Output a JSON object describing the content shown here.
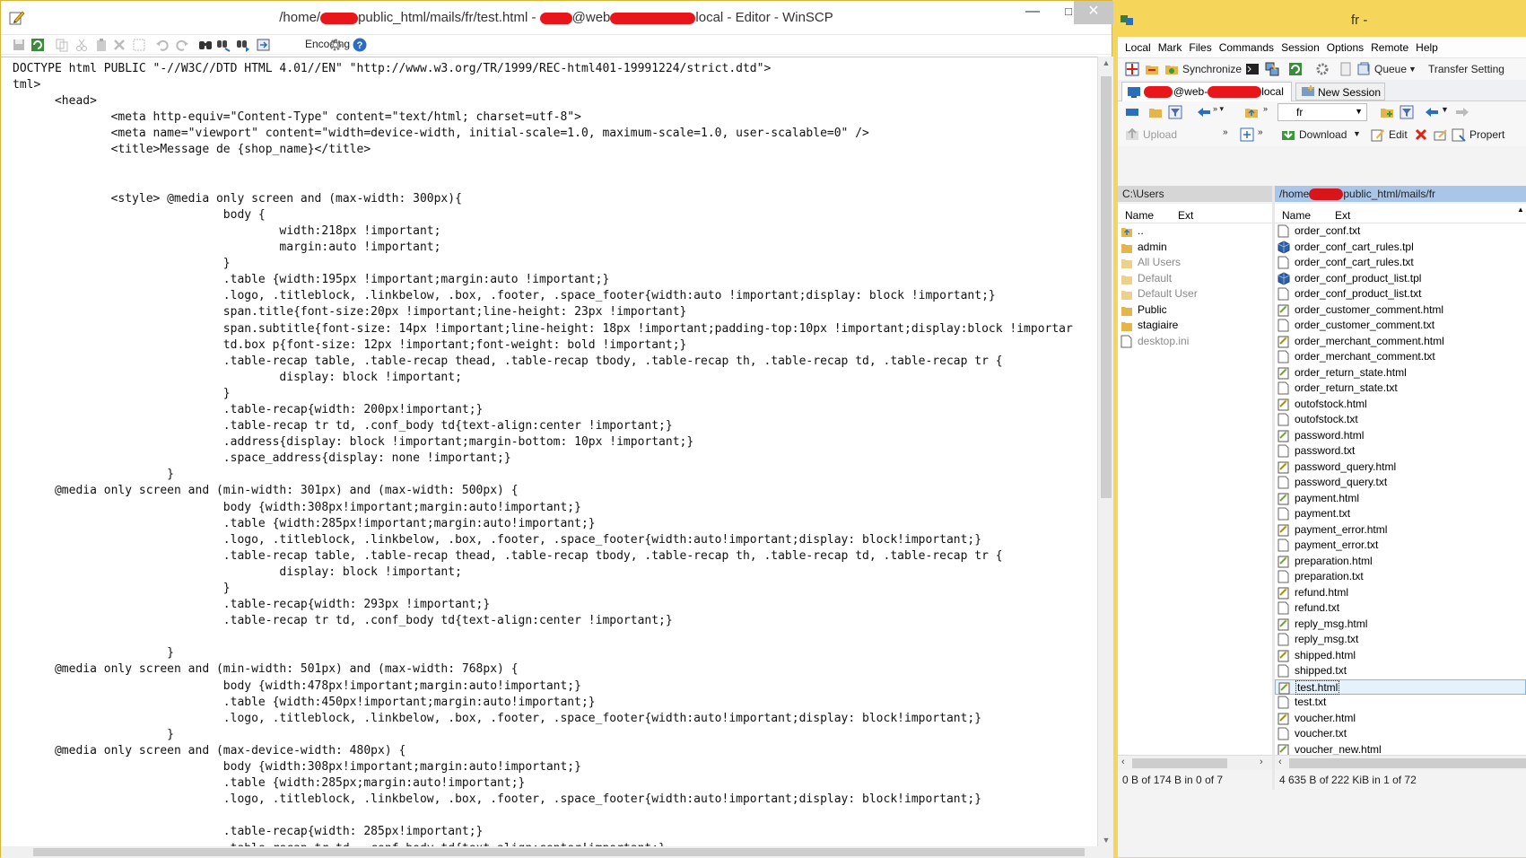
{
  "editor": {
    "title_prefix": "/home/",
    "title_mid": "public_html/mails/fr/test.html - ",
    "title_at": "@web",
    "title_suffix": "local - Editor - WinSCP",
    "minimize": "—",
    "maximize": "□",
    "close": "✕",
    "encoding_label": "Encoding",
    "code_lines": [
      "DOCTYPE html PUBLIC \"-//W3C//DTD HTML 4.01//EN\" \"http://www.w3.org/TR/1999/REC-html401-19991224/strict.dtd\">",
      "tml>",
      "      <head>",
      "              <meta http-equiv=\"Content-Type\" content=\"text/html; charset=utf-8\">",
      "              <meta name=\"viewport\" content=\"width=device-width, initial-scale=1.0, maximum-scale=1.0, user-scalable=0\" />",
      "              <title>Message de {shop_name}</title>",
      "",
      "",
      "              <style> @media only screen and (max-width: 300px){",
      "                              body {",
      "                                      width:218px !important;",
      "                                      margin:auto !important;",
      "                              }",
      "                              .table {width:195px !important;margin:auto !important;}",
      "                              .logo, .titleblock, .linkbelow, .box, .footer, .space_footer{width:auto !important;display: block !important;}",
      "                              span.title{font-size:20px !important;line-height: 23px !important}",
      "                              span.subtitle{font-size: 14px !important;line-height: 18px !important;padding-top:10px !important;display:block !importar",
      "                              td.box p{font-size: 12px !important;font-weight: bold !important;}",
      "                              .table-recap table, .table-recap thead, .table-recap tbody, .table-recap th, .table-recap td, .table-recap tr {",
      "                                      display: block !important;",
      "                              }",
      "                              .table-recap{width: 200px!important;}",
      "                              .table-recap tr td, .conf_body td{text-align:center !important;}",
      "                              .address{display: block !important;margin-bottom: 10px !important;}",
      "                              .space_address{display: none !important;}",
      "                      }",
      "      @media only screen and (min-width: 301px) and (max-width: 500px) {",
      "                              body {width:308px!important;margin:auto!important;}",
      "                              .table {width:285px!important;margin:auto!important;}",
      "                              .logo, .titleblock, .linkbelow, .box, .footer, .space_footer{width:auto!important;display: block!important;}",
      "                              .table-recap table, .table-recap thead, .table-recap tbody, .table-recap th, .table-recap td, .table-recap tr {",
      "                                      display: block !important;",
      "                              }",
      "                              .table-recap{width: 293px !important;}",
      "                              .table-recap tr td, .conf_body td{text-align:center !important;}",
      "",
      "                      }",
      "      @media only screen and (min-width: 501px) and (max-width: 768px) {",
      "                              body {width:478px!important;margin:auto!important;}",
      "                              .table {width:450px!important;margin:auto!important;}",
      "                              .logo, .titleblock, .linkbelow, .box, .footer, .space_footer{width:auto!important;display: block!important;}",
      "                      }",
      "      @media only screen and (max-device-width: 480px) {",
      "                              body {width:308px!important;margin:auto!important;}",
      "                              .table {width:285px;margin:auto!important;}",
      "                              .logo, .titleblock, .linkbelow, .box, .footer, .space_footer{width:auto!important;display: block!important;}",
      "",
      "                              .table-recap{width: 285px!important;}",
      "                              .table-recap tr td, .conf_body td{text-align:center!important;}"
    ]
  },
  "winscp": {
    "title": "fr - ",
    "menu": [
      "Local",
      "Mark",
      "Files",
      "Commands",
      "Session",
      "Options",
      "Remote",
      "Help"
    ],
    "toolbar": {
      "synchronize": "Synchronize",
      "queue": "Queue",
      "transfer_settings": "Transfer Setting"
    },
    "session_tab_label": "@web-",
    "session_tab_suffix": "local",
    "new_session": "New Session",
    "remote_dir": "fr",
    "upload": "Upload",
    "download": "Download",
    "edit": "Edit",
    "properties": "Propert",
    "local": {
      "path": "C:\\Users",
      "col_name": "Name",
      "col_ext": "Ext",
      "items": [
        {
          "name": "..",
          "kind": "up"
        },
        {
          "name": "admin",
          "kind": "folder"
        },
        {
          "name": "All Users",
          "kind": "folder-dim"
        },
        {
          "name": "Default",
          "kind": "folder-dim"
        },
        {
          "name": "Default User",
          "kind": "folder-dim"
        },
        {
          "name": "Public",
          "kind": "folder"
        },
        {
          "name": "stagiaire",
          "kind": "folder"
        },
        {
          "name": "desktop.ini",
          "kind": "file-dim"
        }
      ],
      "status": "0 B of 174 B in 0 of 7"
    },
    "remote": {
      "path_prefix": "/home",
      "path_suffix": "public_html/mails/fr",
      "col_name": "Name",
      "col_ext": "Ext",
      "items": [
        {
          "name": "order_conf.txt",
          "kind": "txt"
        },
        {
          "name": "order_conf_cart_rules.tpl",
          "kind": "tpl"
        },
        {
          "name": "order_conf_cart_rules.txt",
          "kind": "txt"
        },
        {
          "name": "order_conf_product_list.tpl",
          "kind": "tpl"
        },
        {
          "name": "order_conf_product_list.txt",
          "kind": "txt"
        },
        {
          "name": "order_customer_comment.html",
          "kind": "html"
        },
        {
          "name": "order_customer_comment.txt",
          "kind": "txt"
        },
        {
          "name": "order_merchant_comment.html",
          "kind": "html"
        },
        {
          "name": "order_merchant_comment.txt",
          "kind": "txt"
        },
        {
          "name": "order_return_state.html",
          "kind": "html"
        },
        {
          "name": "order_return_state.txt",
          "kind": "txt"
        },
        {
          "name": "outofstock.html",
          "kind": "html"
        },
        {
          "name": "outofstock.txt",
          "kind": "txt"
        },
        {
          "name": "password.html",
          "kind": "html"
        },
        {
          "name": "password.txt",
          "kind": "txt"
        },
        {
          "name": "password_query.html",
          "kind": "html"
        },
        {
          "name": "password_query.txt",
          "kind": "txt"
        },
        {
          "name": "payment.html",
          "kind": "html"
        },
        {
          "name": "payment.txt",
          "kind": "txt"
        },
        {
          "name": "payment_error.html",
          "kind": "html"
        },
        {
          "name": "payment_error.txt",
          "kind": "txt"
        },
        {
          "name": "preparation.html",
          "kind": "html"
        },
        {
          "name": "preparation.txt",
          "kind": "txt"
        },
        {
          "name": "refund.html",
          "kind": "html"
        },
        {
          "name": "refund.txt",
          "kind": "txt"
        },
        {
          "name": "reply_msg.html",
          "kind": "html"
        },
        {
          "name": "reply_msg.txt",
          "kind": "txt"
        },
        {
          "name": "shipped.html",
          "kind": "html"
        },
        {
          "name": "shipped.txt",
          "kind": "txt"
        },
        {
          "name": "test.html",
          "kind": "html",
          "selected": true
        },
        {
          "name": "test.txt",
          "kind": "txt"
        },
        {
          "name": "voucher.html",
          "kind": "html"
        },
        {
          "name": "voucher.txt",
          "kind": "txt"
        },
        {
          "name": "voucher_new.html",
          "kind": "html"
        }
      ],
      "status": "4 635 B of 222 KiB in 1 of 72"
    }
  }
}
